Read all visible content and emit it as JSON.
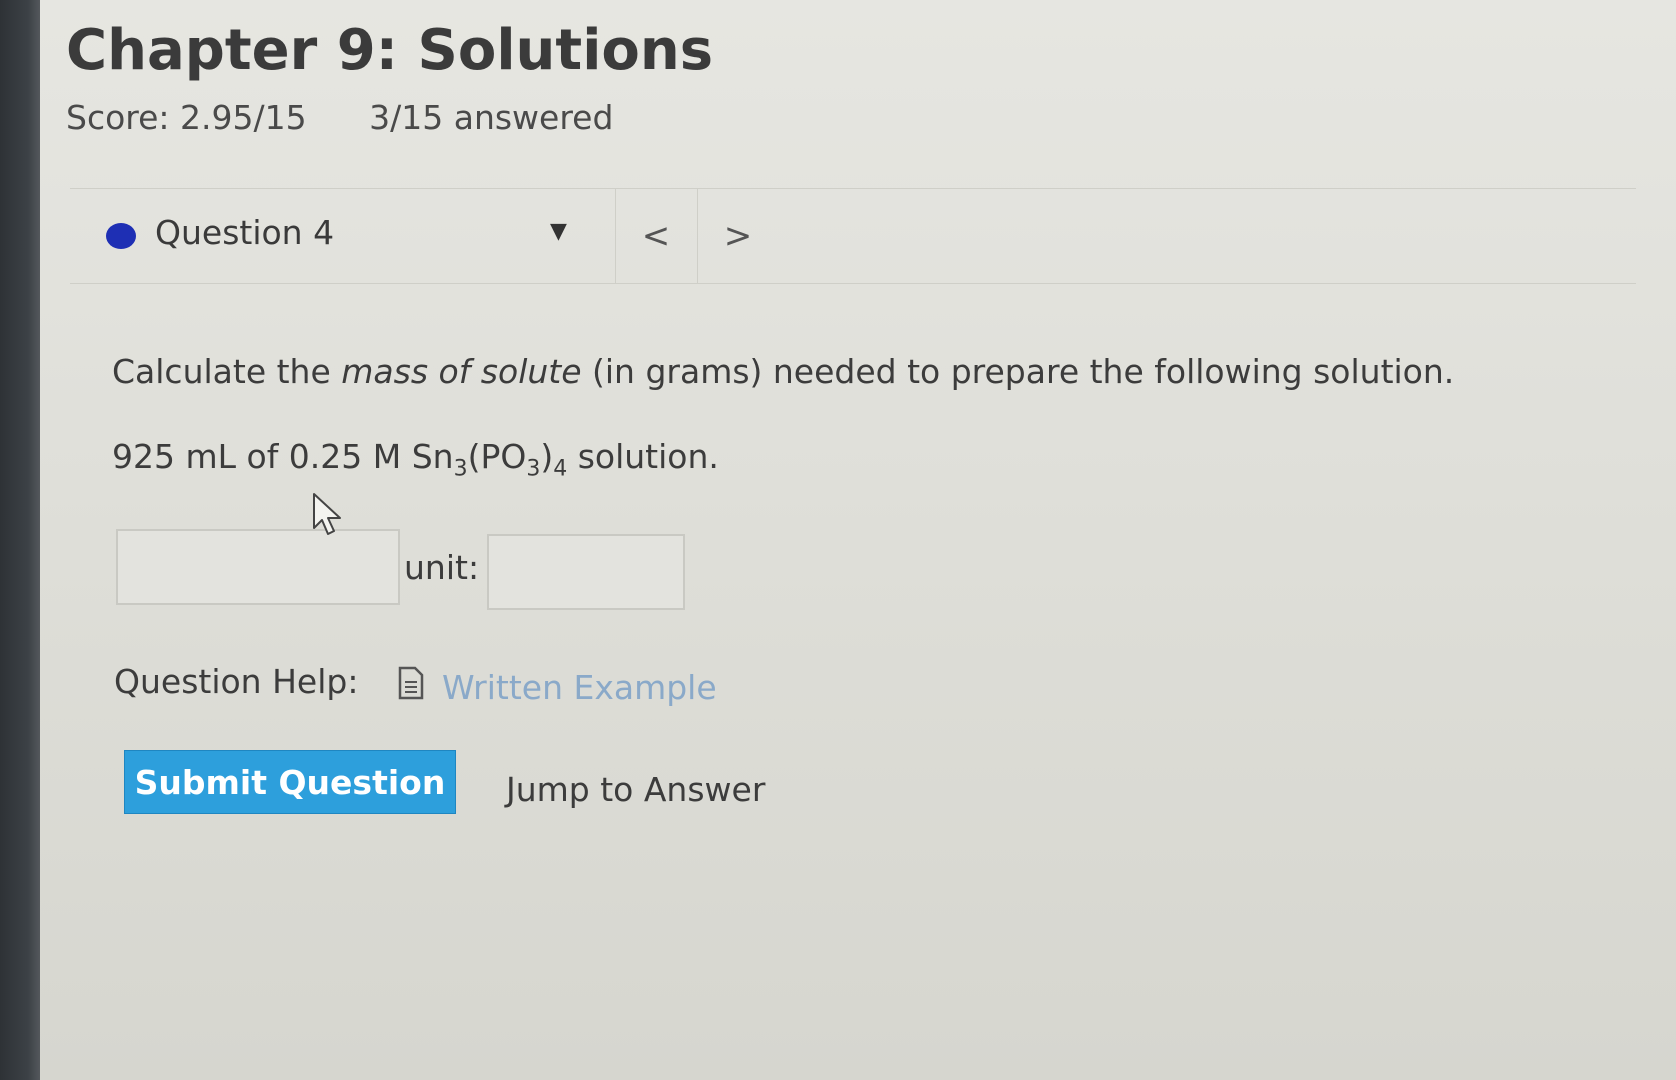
{
  "header": {
    "title": "Chapter 9: Solutions",
    "score": "Score: 2.95/15",
    "answered": "3/15 answered"
  },
  "question_nav": {
    "label": "Question 4",
    "status_color": "#1e2fb4",
    "prev": "<",
    "next": ">"
  },
  "question": {
    "intro": "Calculate the ",
    "emphasis": "mass of solute",
    "rest": " (in grams) needed to prepare the following solution.",
    "solution_prefix": "925 mL of 0.25 M Sn",
    "sub1": "3",
    "mid1": "(PO",
    "sub2": "3",
    "mid2": ")",
    "sub3": "4",
    "suffix": " solution."
  },
  "answer": {
    "value": "",
    "unit_label": "unit:",
    "unit_value": ""
  },
  "help": {
    "label": "Question Help:",
    "link": "Written Example"
  },
  "actions": {
    "submit": "Submit Question",
    "jump": "Jump to Answer"
  },
  "colors": {
    "accent": "#2d9fdc",
    "link": "#8aa9c9"
  }
}
